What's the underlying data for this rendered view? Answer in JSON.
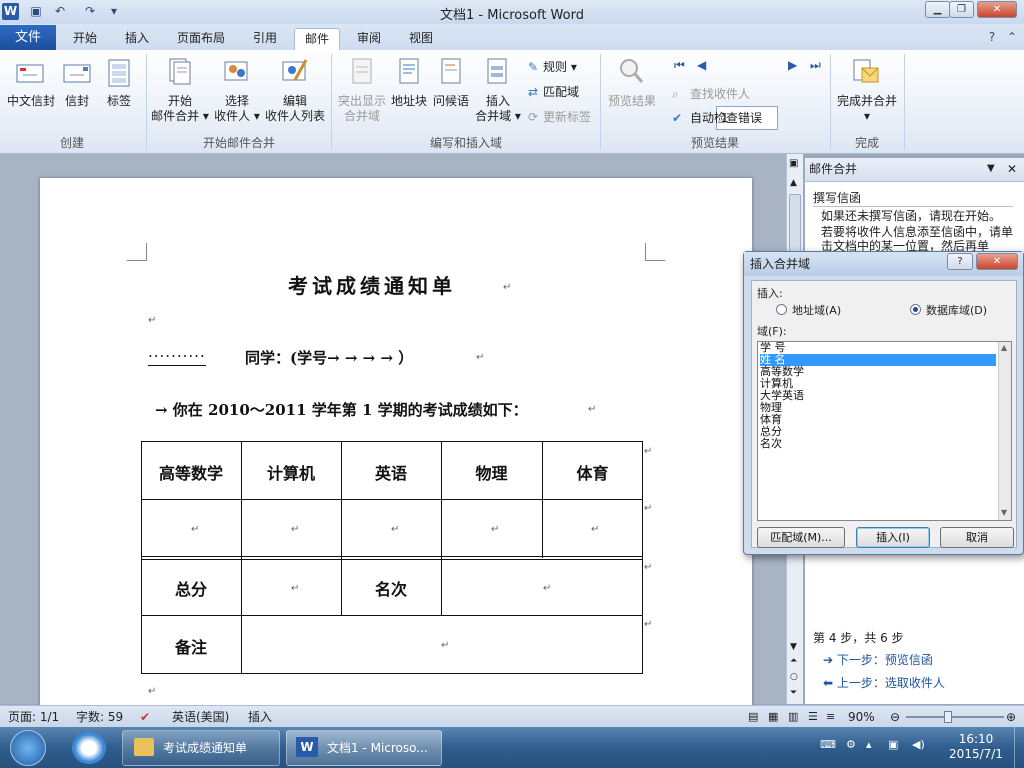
{
  "window": {
    "title": "文档1 - Microsoft Word",
    "logo": "W"
  },
  "tabs": {
    "file": "文件",
    "items": [
      "开始",
      "插入",
      "页面布局",
      "引用",
      "邮件",
      "审阅",
      "视图"
    ],
    "active": "邮件"
  },
  "ribbon": {
    "create": {
      "group_label": "创建",
      "chinese_envelope": "中文信封",
      "envelope": "信封",
      "labels": "标签"
    },
    "start_merge": {
      "group_label": "开始邮件合并",
      "start_l1": "开始",
      "start_l2": "邮件合并 ▾",
      "select_l1": "选择",
      "select_l2": "收件人 ▾",
      "edit_l1": "编辑",
      "edit_l2": "收件人列表"
    },
    "write_insert": {
      "group_label": "编写和插入域",
      "highlight_l1": "突出显示",
      "highlight_l2": "合并域",
      "address_block": "地址块",
      "greeting": "问候语",
      "insert_l1": "插入",
      "insert_l2": "合并域 ▾",
      "rules": "规则 ▾",
      "match_fields": "匹配域",
      "update_labels": "更新标签"
    },
    "preview": {
      "group_label": "预览结果",
      "preview_results": "预览结果",
      "record": "1",
      "find_recipient": "查找收件人",
      "auto_check": "自动检查错误"
    },
    "finish": {
      "group_label": "完成",
      "finish_merge": "完成并合并",
      "finish_arrow": "▾"
    }
  },
  "document": {
    "title": "考试成绩通知单",
    "line1_prefix": "··········",
    "line1": "同学：(学号→ → → → ）",
    "line2": "→ 你在 2010～2011 学年第 1 学期的考试成绩如下：",
    "table_headers": [
      "高等数学",
      "计算机",
      "英语",
      "物理",
      "体育"
    ],
    "total_label": "总分",
    "rank_label": "名次",
    "remark_label": "备注",
    "para_mark": "↵"
  },
  "task_pane": {
    "title": "邮件合并",
    "section": "撰写信函",
    "text1": "如果还未撰写信函，请现在开始。",
    "text2": "若要将收件人信息添至信函中，请单击文档中的某一位置，然后再单",
    "step": "第 4 步，共 6 步",
    "next": "下一步：预览信函",
    "prev": "上一步：选取收件人"
  },
  "dialog": {
    "title": "插入合并域",
    "help": "?",
    "insert_label": "插入:",
    "radio_address": "地址域(A)",
    "radio_database": "数据库域(D)",
    "fields_label": "域(F):",
    "fields": [
      "学  号",
      "姓  名",
      "高等数学",
      "计算机",
      "大学英语",
      "物理",
      "体育",
      "总分",
      "名次"
    ],
    "selected_field": "姓  名",
    "match_button": "匹配域(M)...",
    "insert_button": "插入(I)",
    "cancel_button": "取消"
  },
  "status_bar": {
    "page": "页面: 1/1",
    "words": "字数: 59",
    "language": "英语(美国)",
    "mode": "插入",
    "zoom": "90%"
  },
  "taskbar": {
    "item1": "考试成绩通知单",
    "item2": "文档1 - Microso...",
    "time": "16:10",
    "date": "2015/7/1"
  },
  "colors": {
    "accent": "#2a5ba8",
    "file_tab": "#1c4f9c",
    "selection": "#3399ff",
    "taskbar": "#2f5d8c"
  }
}
